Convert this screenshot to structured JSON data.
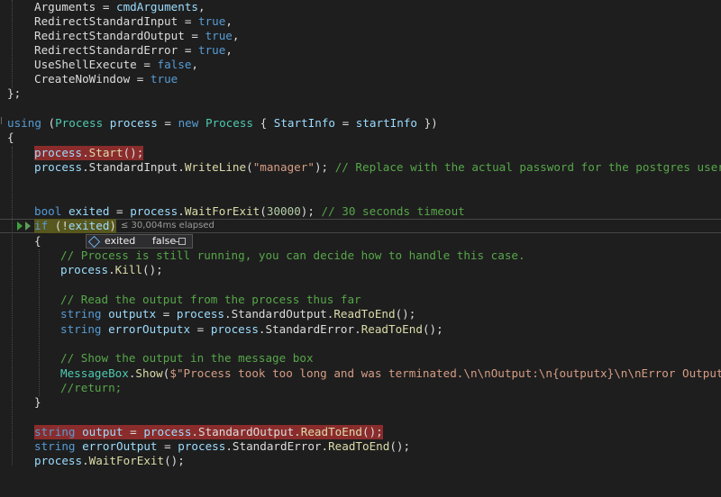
{
  "editor": {
    "lines": {
      "l1": {
        "a": "Arguments",
        "b": " = ",
        "c": "cmdArguments",
        "d": ","
      },
      "l2": {
        "a": "RedirectStandardInput",
        "b": " = ",
        "c": "true",
        "d": ","
      },
      "l3": {
        "a": "RedirectStandardOutput",
        "b": " = ",
        "c": "true",
        "d": ","
      },
      "l4": {
        "a": "RedirectStandardError",
        "b": " = ",
        "c": "true",
        "d": ","
      },
      "l5": {
        "a": "UseShellExecute",
        "b": " = ",
        "c": "false",
        "d": ","
      },
      "l6": {
        "a": "CreateNoWindow",
        "b": " = ",
        "c": "true"
      },
      "l7": {
        "a": "};"
      },
      "l8": {
        "a": "using",
        "b": " (",
        "c": "Process",
        "d": " ",
        "e": "process",
        "f": " = ",
        "g": "new",
        "h": " ",
        "i": "Process",
        "j": " { ",
        "k": "StartInfo",
        "l": " = ",
        "m": "startInfo",
        "n": " })"
      },
      "l9": {
        "a": "{"
      },
      "l10": {
        "a": "process",
        "b": ".",
        "c": "Start",
        "d": "();"
      },
      "l11": {
        "a": "process",
        "b": ".",
        "c": "StandardInput",
        "d": ".",
        "e": "WriteLine",
        "f": "(",
        "g": "\"manager\"",
        "h": "); ",
        "i": "// Replace with the actual password for the postgres user"
      },
      "l12": {
        "a": "bool",
        "b": " ",
        "c": "exited",
        "d": " = ",
        "e": "process",
        "f": ".",
        "g": "WaitForExit",
        "h": "(",
        "i": "30000",
        "j": "); ",
        "k": "// 30 seconds timeout"
      },
      "l13": {
        "a": "if",
        "b": " (!",
        "c": "exited",
        "d": ")"
      },
      "l14": {
        "a": "{"
      },
      "l15": {
        "a": "// Process is still running, you can decide how to handle this case."
      },
      "l16": {
        "a": "process",
        "b": ".",
        "c": "Kill",
        "d": "();"
      },
      "l17": {
        "a": "// Read the output from the process thus far"
      },
      "l18": {
        "a": "string",
        "b": " ",
        "c": "outputx",
        "d": " = ",
        "e": "process",
        "f": ".",
        "g": "StandardOutput",
        "h": ".",
        "i": "ReadToEnd",
        "j": "();"
      },
      "l19": {
        "a": "string",
        "b": " ",
        "c": "errorOutputx",
        "d": " = ",
        "e": "process",
        "f": ".",
        "g": "StandardError",
        "h": ".",
        "i": "ReadToEnd",
        "j": "();"
      },
      "l20": {
        "a": "// Show the output in the message box"
      },
      "l21": {
        "a": "MessageBox",
        "b": ".",
        "c": "Show",
        "d": "(",
        "e": "$\"Process took too long and was terminated.\\n\\nOutput:\\n{outputx}\\n\\nError Output:\\n"
      },
      "l22": {
        "a": "//return;"
      },
      "l23": {
        "a": "}"
      },
      "l24": {
        "a": "string",
        "b": " ",
        "c": "output",
        "d": " = ",
        "e": "process",
        "f": ".",
        "g": "StandardOutput",
        "h": ".",
        "i": "ReadToEnd",
        "j": "();"
      },
      "l25": {
        "a": "string",
        "b": " ",
        "c": "errorOutput",
        "d": " = ",
        "e": "process",
        "f": ".",
        "g": "StandardError",
        "h": ".",
        "i": "ReadToEnd",
        "j": "();"
      },
      "l26": {
        "a": "process",
        "b": ".",
        "c": "WaitForExit",
        "d": "();"
      }
    },
    "elapsed_hint": "≤ 30,004ms elapsed",
    "datatip": {
      "name": "exited",
      "value": "false"
    }
  },
  "colors": {
    "background": "#1e1e1e",
    "breakpoint": "#8a2c2c",
    "current_statement": "#57571e",
    "keyword": "#569cd6",
    "type": "#4ec9b0",
    "method": "#dcdcaa",
    "variable": "#9cdcfe",
    "string": "#d69d85",
    "comment": "#57a64a",
    "number": "#b5cea8"
  }
}
